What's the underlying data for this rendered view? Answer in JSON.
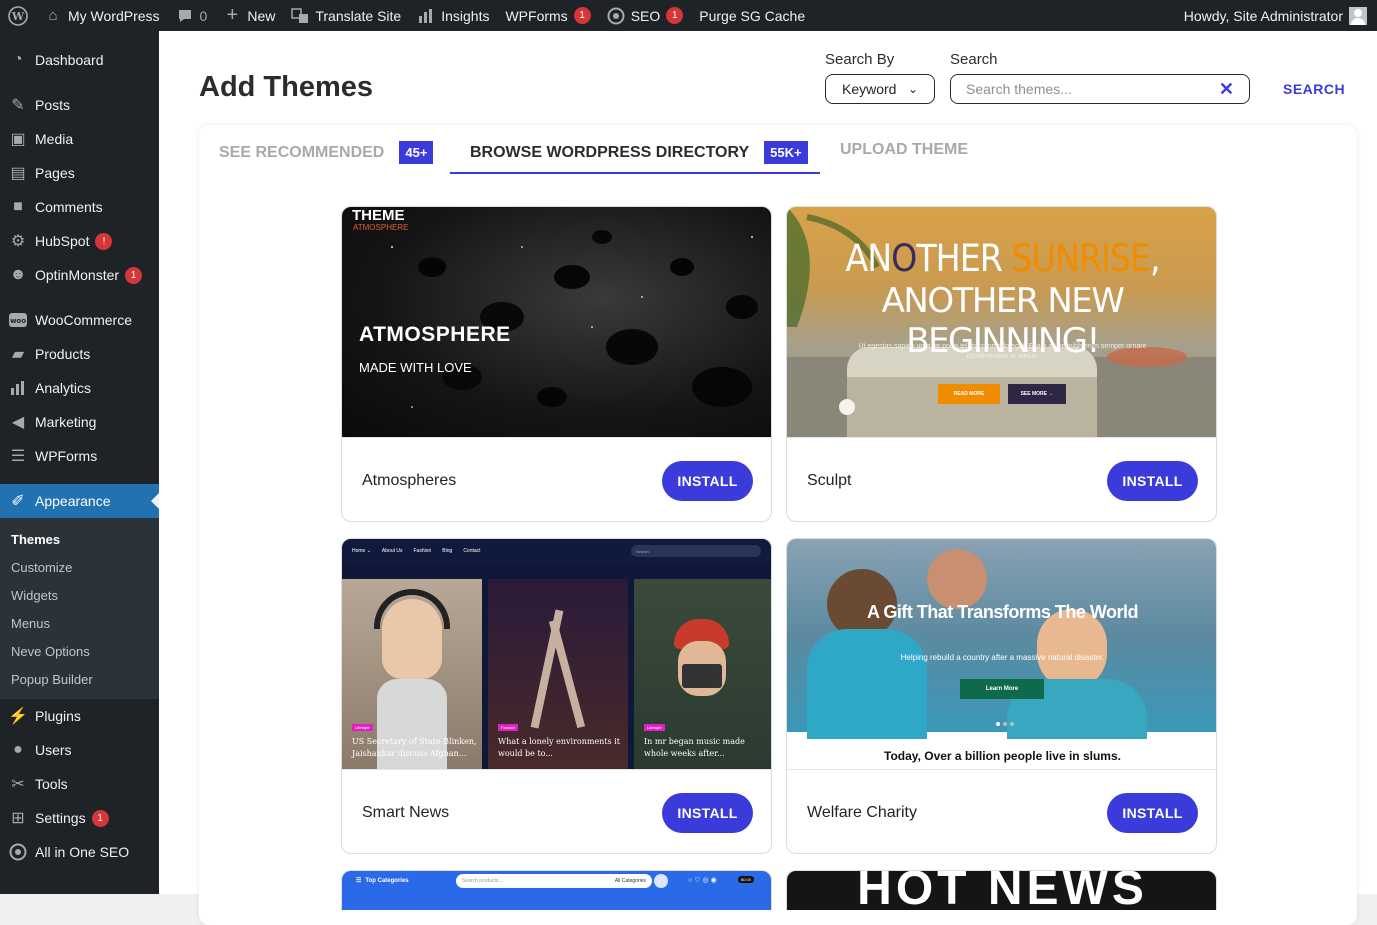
{
  "adminbar": {
    "site": "My WordPress",
    "comments_count": "0",
    "new": "New",
    "translate": "Translate Site",
    "insights": "Insights",
    "wpforms": "WPForms",
    "wpforms_badge": "1",
    "seo": "SEO",
    "seo_badge": "1",
    "purge": "Purge SG Cache",
    "howdy": "Howdy, Site Administrator"
  },
  "sidebar": {
    "items": [
      {
        "label": "Dashboard",
        "icon": "dashboard-icon"
      },
      {
        "label": "Posts",
        "icon": "pin-icon"
      },
      {
        "label": "Media",
        "icon": "media-icon"
      },
      {
        "label": "Pages",
        "icon": "page-icon"
      },
      {
        "label": "Comments",
        "icon": "comment-icon"
      },
      {
        "label": "HubSpot",
        "icon": "hubspot-icon",
        "badge": "!"
      },
      {
        "label": "OptinMonster",
        "icon": "optinmonster-icon",
        "badge": "1"
      },
      {
        "label": "WooCommerce",
        "icon": "woo-icon"
      },
      {
        "label": "Products",
        "icon": "archive-icon"
      },
      {
        "label": "Analytics",
        "icon": "bar-chart-icon"
      },
      {
        "label": "Marketing",
        "icon": "megaphone-icon"
      },
      {
        "label": "WPForms",
        "icon": "form-icon"
      },
      {
        "label": "Appearance",
        "icon": "brush-icon"
      },
      {
        "label": "Plugins",
        "icon": "plug-icon"
      },
      {
        "label": "Users",
        "icon": "user-icon"
      },
      {
        "label": "Tools",
        "icon": "wrench-icon"
      },
      {
        "label": "Settings",
        "icon": "settings-icon",
        "badge": "1"
      },
      {
        "label": "All in One SEO",
        "icon": "aioseo-icon"
      }
    ],
    "submenu": [
      "Themes",
      "Customize",
      "Widgets",
      "Menus",
      "Neve Options",
      "Popup Builder"
    ]
  },
  "main": {
    "title": "Add Themes",
    "search_by_label": "Search By",
    "search_by_value": "Keyword",
    "search_label": "Search",
    "search_placeholder": "Search themes...",
    "search_button": "SEARCH",
    "tabs": [
      {
        "label": "SEE RECOMMENDED",
        "badge": "45+"
      },
      {
        "label": "BROWSE WORDPRESS DIRECTORY",
        "badge": "55K+"
      },
      {
        "label": "UPLOAD THEME"
      }
    ],
    "install_label": "INSTALL",
    "themes": [
      {
        "name": "Atmospheres",
        "thumb_title": "ATMOSPHERE",
        "thumb_sub": "MADE WITH LOVE",
        "thumb_top": "THEME",
        "thumb_top2": "ATMOSPHERE"
      },
      {
        "name": "Sculpt",
        "thumb_line1a": "AN",
        "thumb_line1b": "O",
        "thumb_line1c": "THER ",
        "thumb_line1d": "SUNRISE",
        "thumb_line1e": ",",
        "thumb_line2": "ANOTHER NEW BEGINNING!",
        "thumb_body": "Ut egestas sapien urna, at porta tellus commodo eget. Etiam ac vel nibh enim semper ornare condimentum in metus.",
        "btn1": "READ MORE",
        "btn2": "SEE MORE →"
      },
      {
        "name": "Smart News",
        "nav": [
          "Home ⌄",
          "About Us",
          "Fashion",
          "Blog",
          "Contact"
        ],
        "search_ph": "Search",
        "tags": [
          "Lifestyle",
          "Fashion",
          "Lifestyle"
        ],
        "captions": [
          "US Secretary of State Blinken, Jaishankar discuss Afghan...",
          "What a lonely environments it would be to...",
          "In mr began music made whole weeks after..."
        ]
      },
      {
        "name": "Welfare Charity",
        "hero_title": "A Gift That Transforms The World",
        "hero_sub": "Helping rebuild a country after a massive natural disaster.",
        "hero_btn": "Learn More",
        "bottom": "Today, Over a billion people live in slums."
      }
    ],
    "partial": [
      {
        "cat": "Top Categories",
        "search_ph": "Search products...",
        "select": "All Categories",
        "price": "$0.00"
      },
      {
        "headline": "HOT NEWS"
      }
    ]
  }
}
